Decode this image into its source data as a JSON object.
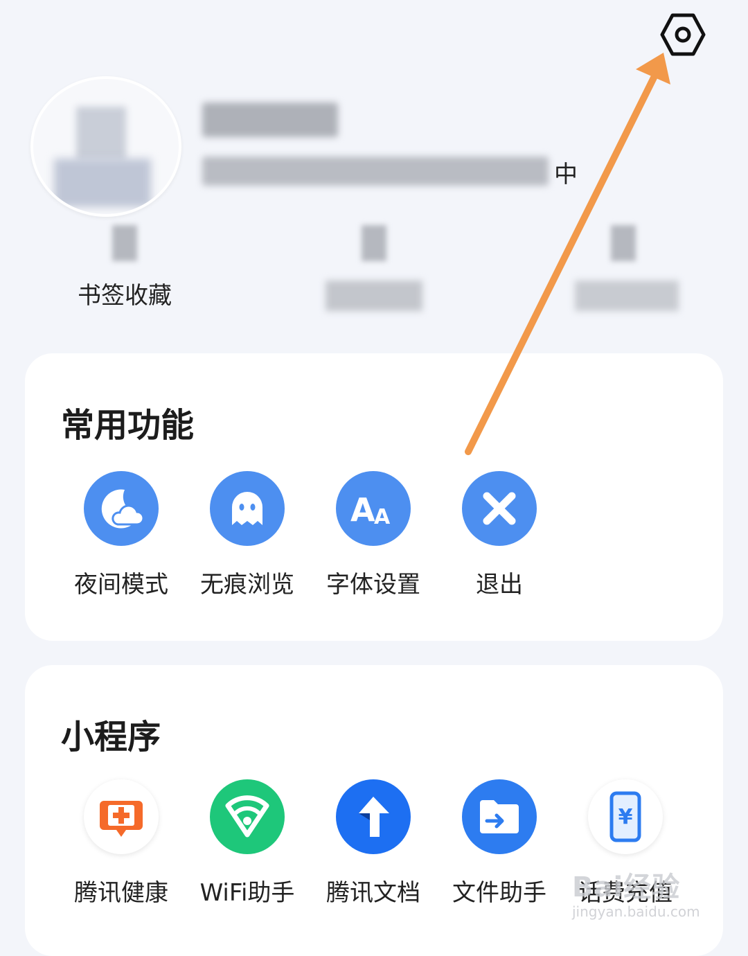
{
  "header": {
    "username": "",
    "subtitle_tail": "中",
    "settings_icon": "settings-hexagon-icon"
  },
  "stats": [
    {
      "value": "",
      "label": "书签收藏"
    },
    {
      "value": "",
      "label": ""
    },
    {
      "value": "",
      "label": ""
    }
  ],
  "common_functions": {
    "title": "常用功能",
    "items": [
      {
        "label": "夜间模式",
        "icon": "night-mode-icon"
      },
      {
        "label": "无痕浏览",
        "icon": "incognito-ghost-icon"
      },
      {
        "label": "字体设置",
        "icon": "font-settings-icon"
      },
      {
        "label": "退出",
        "icon": "exit-x-icon"
      }
    ]
  },
  "mini_programs": {
    "title": "小程序",
    "items": [
      {
        "label": "腾讯健康",
        "icon": "tencent-health-icon"
      },
      {
        "label": "WiFi助手",
        "icon": "wifi-assistant-icon"
      },
      {
        "label": "腾讯文档",
        "icon": "tencent-docs-icon"
      },
      {
        "label": "文件助手",
        "icon": "file-assistant-icon"
      },
      {
        "label": "话费充值",
        "icon": "phone-recharge-icon"
      }
    ]
  },
  "watermark": {
    "main": "Bai经验",
    "sub": "jingyan.baidu.com"
  },
  "colors": {
    "accent": "#4d8ff0",
    "arrow": "#f2994a",
    "background": "#f3f5fa"
  }
}
